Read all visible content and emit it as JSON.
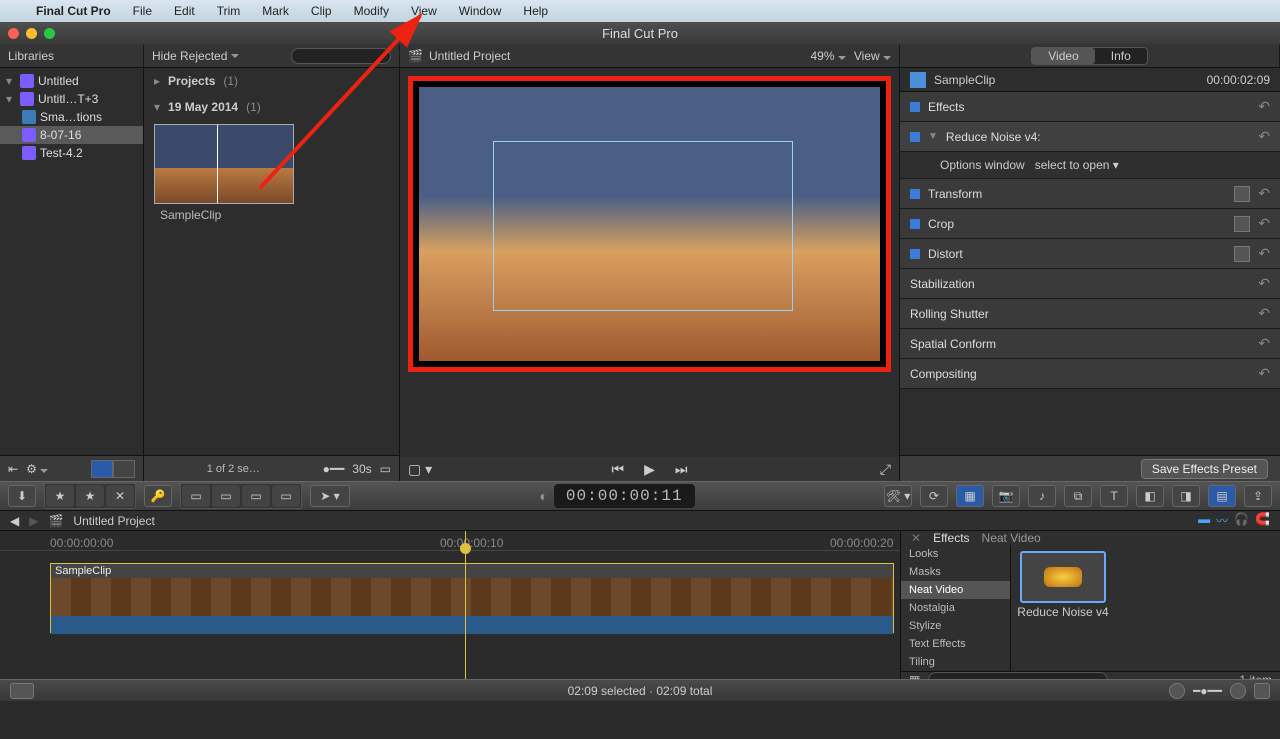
{
  "menubar": {
    "app_name": "Final Cut Pro",
    "items": [
      "File",
      "Edit",
      "Trim",
      "Mark",
      "Clip",
      "Modify",
      "View",
      "Window",
      "Help"
    ]
  },
  "window_title": "Final Cut Pro",
  "toolbarA": {
    "libraries_label": "Libraries",
    "hide_rejected": "Hide Rejected",
    "project_title": "Untitled Project",
    "zoom_pct": "49%",
    "view_label": "View"
  },
  "libraries": [
    {
      "label": "Untitled",
      "indent": 0,
      "icon": "star"
    },
    {
      "label": "Untitl…T+3",
      "indent": 0,
      "icon": "star"
    },
    {
      "label": "Sma…tions",
      "indent": 1,
      "icon": "folder"
    },
    {
      "label": "8-07-16",
      "indent": 1,
      "icon": "star",
      "selected": true
    },
    {
      "label": "Test-4.2",
      "indent": 1,
      "icon": "star"
    }
  ],
  "browser": {
    "projects_label": "Projects",
    "projects_count": "(1)",
    "date_label": "19 May 2014",
    "date_count": "(1)",
    "clip_label": "SampleClip",
    "status": "1 of 2 se…",
    "duration": "30s"
  },
  "inspector": {
    "tabs": {
      "video": "Video",
      "info": "Info"
    },
    "clip_name": "SampleClip",
    "clip_tc": "00:00:02:09",
    "sections": [
      {
        "label": "Effects",
        "kind": "hdr"
      },
      {
        "label": "Reduce Noise v4:",
        "kind": "sub",
        "expanded": true
      },
      {
        "label": "Transform",
        "kind": "hdr",
        "ricon": true
      },
      {
        "label": "Crop",
        "kind": "hdr",
        "ricon": true
      },
      {
        "label": "Distort",
        "kind": "hdr",
        "ricon": true
      },
      {
        "label": "Stabilization",
        "kind": "hdr"
      },
      {
        "label": "Rolling Shutter",
        "kind": "hdr"
      },
      {
        "label": "Spatial Conform",
        "kind": "hdr"
      },
      {
        "label": "Compositing",
        "kind": "hdr"
      }
    ],
    "options_label": "Options window",
    "options_value": "select to open",
    "save_preset": "Save Effects Preset"
  },
  "strip_tc": "00:00:00:11",
  "timeline": {
    "project": "Untitled Project",
    "ruler": [
      "00:00:00:00",
      "00:00:00:10",
      "00:00:00:20"
    ],
    "clip_name": "SampleClip"
  },
  "fx": {
    "tab_effects": "Effects",
    "tab_neat": "Neat Video",
    "cats": [
      "Looks",
      "Masks",
      "Neat Video",
      "Nostalgia",
      "Stylize",
      "Text Effects",
      "Tiling"
    ],
    "item_label": "Reduce Noise v4",
    "count": "1 item"
  },
  "status": "02:09 selected · 02:09 total"
}
